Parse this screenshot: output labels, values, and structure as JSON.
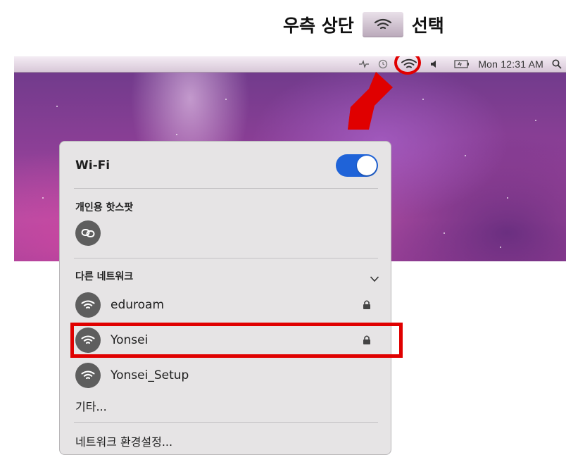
{
  "instruction": {
    "prefix": "우측 상단",
    "suffix": "선택"
  },
  "menubar": {
    "clock": "Mon 12:31 AM"
  },
  "wifi_panel": {
    "title": "Wi-Fi",
    "toggle_on": true,
    "hotspot_section": "개인용 핫스팟",
    "other_networks_section": "다른 네트워크",
    "networks": [
      {
        "name": "eduroam",
        "locked": true
      },
      {
        "name": "Yonsei",
        "locked": true
      },
      {
        "name": "Yonsei_Setup",
        "locked": false
      }
    ],
    "other": "기타...",
    "settings": "네트워크 환경설정..."
  },
  "colors": {
    "highlight": "#e00000",
    "toggle": "#1f63d8"
  }
}
